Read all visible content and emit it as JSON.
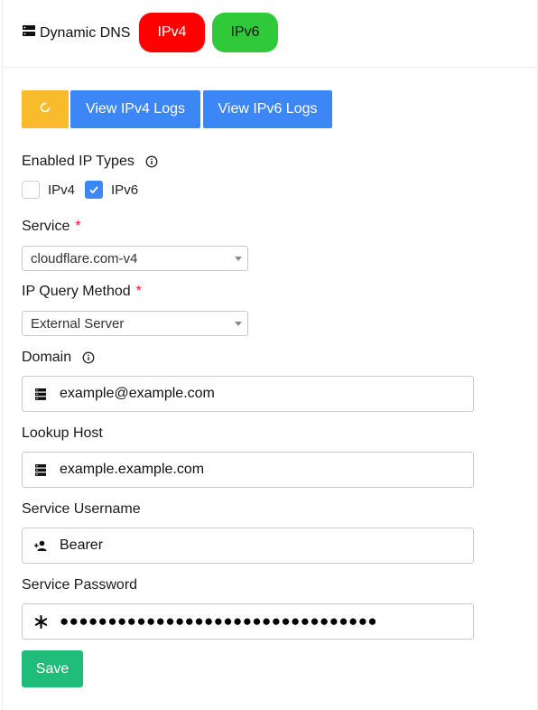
{
  "header": {
    "title": "Dynamic DNS",
    "ipv4_pill": "IPv4",
    "ipv6_pill": "IPv6",
    "ipv4_color": "#ff0000",
    "ipv6_color": "#2fc93a"
  },
  "toolbar": {
    "refresh_icon": "refresh-icon",
    "view_ipv4_logs": "View IPv4 Logs",
    "view_ipv6_logs": "View IPv6 Logs"
  },
  "form": {
    "enabled_ip_types": {
      "label": "Enabled IP Types",
      "options": [
        {
          "label": "IPv4",
          "checked": false
        },
        {
          "label": "IPv6",
          "checked": true
        }
      ]
    },
    "service": {
      "label": "Service",
      "required": "*",
      "value": "cloudflare.com-v4"
    },
    "ip_query_method": {
      "label": "IP Query Method",
      "required": "*",
      "value": "External Server"
    },
    "domain": {
      "label": "Domain",
      "value": "example@example.com",
      "icon": "server-icon"
    },
    "lookup_host": {
      "label": "Lookup Host",
      "value": "example.example.com",
      "icon": "server-icon"
    },
    "service_username": {
      "label": "Service Username",
      "value": "Bearer",
      "icon": "user-add-icon"
    },
    "service_password": {
      "label": "Service Password",
      "value": "●●●●●●●●●●●●●●●●●●●●●●●●●●●●●●●●●",
      "icon": "asterisk-icon"
    },
    "save_label": "Save"
  },
  "colors": {
    "primary_button": "#3d86f5",
    "warning_button": "#f7bb2b",
    "save_button": "#20bd7a",
    "required_mark": "#e81c1c"
  }
}
